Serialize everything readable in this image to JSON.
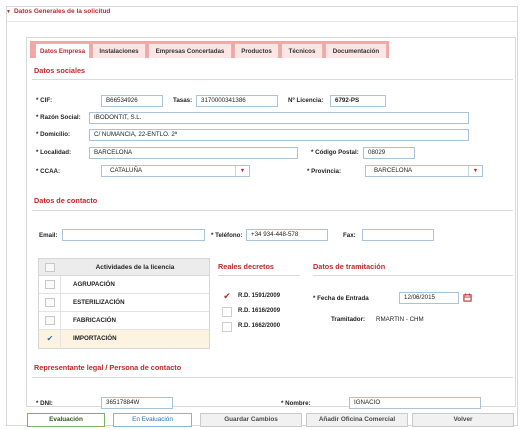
{
  "section": {
    "title": "Datos Generales de la solicitud"
  },
  "tabs": [
    {
      "label": "Datos Empresa",
      "active": true
    },
    {
      "label": "Instalaciones"
    },
    {
      "label": "Empresas Concertadas"
    },
    {
      "label": "Productos"
    },
    {
      "label": "Técnicos"
    },
    {
      "label": "Documentación"
    }
  ],
  "datos_sociales": {
    "heading": "Datos sociales",
    "cif_label": "* CIF:",
    "cif_value": "B66534926",
    "tasas_label": "Tasas:",
    "tasas_value": "3170000341386",
    "licencia_label": "Nº Licencia:",
    "licencia_value": "6792-PS",
    "razon_label": "* Razón Social:",
    "razon_value": "IBODONTIT, S.L.",
    "domicilio_label": "* Domicilio:",
    "domicilio_value": "C/ NUMANCIA, 22-ENTLO. 2ª",
    "localidad_label": "* Localidad:",
    "localidad_value": "BARCELONA",
    "cp_label": "* Código Postal:",
    "cp_value": "08029",
    "ccaa_label": "* CCAA:",
    "ccaa_value": "CATALUÑA",
    "provincia_label": "* Provincia:",
    "provincia_value": "BARCELONA"
  },
  "contacto": {
    "heading": "Datos de contacto",
    "email_label": "Email:",
    "email_value": "",
    "telefono_label": "* Teléfono:",
    "telefono_value": "+34 934-448-578",
    "fax_label": "Fax:",
    "fax_value": ""
  },
  "actividades": {
    "header": "Actividades de la licencia",
    "rows": [
      {
        "label": "AGRUPACIÓN",
        "checked": false
      },
      {
        "label": "ESTERILIZACIÓN",
        "checked": false
      },
      {
        "label": "FABRICACIÓN",
        "checked": false
      },
      {
        "label": "IMPORTACIÓN",
        "checked": true
      }
    ]
  },
  "reales_decretos": {
    "heading": "Reales decretos",
    "items": [
      {
        "label": "R.D. 1591/2009",
        "checked": true
      },
      {
        "label": "R.D. 1616/2009",
        "checked": false
      },
      {
        "label": "R.D. 1662/2000",
        "checked": false
      }
    ]
  },
  "tramitacion": {
    "heading": "Datos de tramitación",
    "fecha_label": "* Fecha de Entrada",
    "fecha_value": "12/06/2015",
    "tramitador_label": "Tramitador:",
    "tramitador_value": "RMARTIN - CHM"
  },
  "representante": {
    "heading": "Representante legal / Persona de contacto",
    "dni_label": "* DNI:",
    "dni_value": "36517884W",
    "nombre_label": "* Nombre:",
    "nombre_value": "IGNACIO"
  },
  "buttons": {
    "evaluacion": "Evaluación",
    "en_evaluacion": "En Evaluación",
    "guardar": "Guardar Cambios",
    "anadir": "Añadir Oficina Comercial",
    "volver": "Volver"
  },
  "colors": {
    "accent": "#c0282a",
    "tab_strip": "#f3a6a4",
    "input_border": "#a9c3dd",
    "check_blue": "#2a6fb5"
  }
}
